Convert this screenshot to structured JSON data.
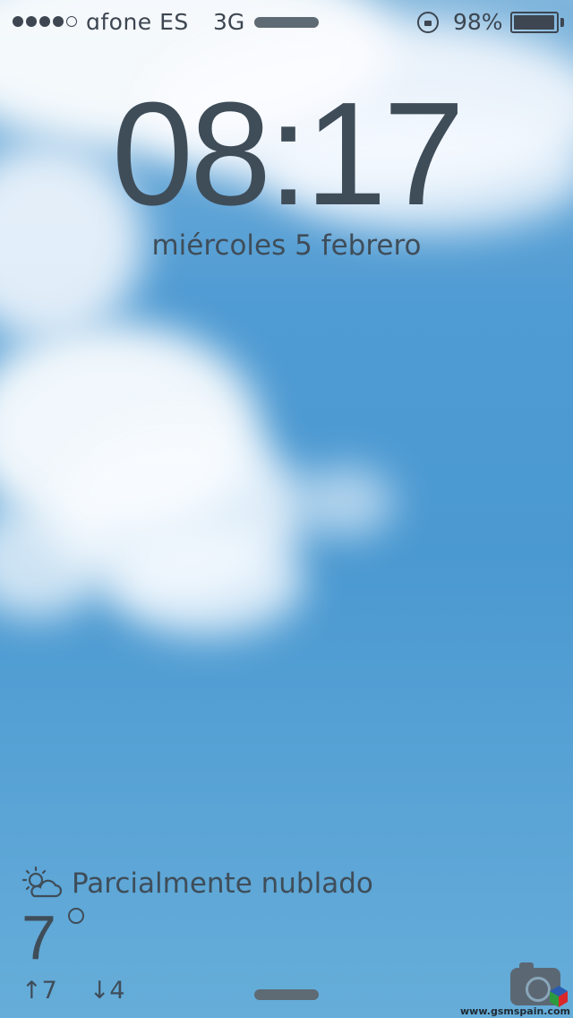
{
  "status_bar": {
    "signal_dots_filled": 4,
    "signal_dots_total": 5,
    "carrier": "ɑfone ES",
    "network": "3G",
    "battery_percent": "98%",
    "battery_level": 0.98,
    "icons": [
      "signal-icon",
      "rotation-lock-icon",
      "battery-icon"
    ]
  },
  "lock_screen": {
    "time": "08:17",
    "date": "miércoles 5 febrero"
  },
  "weather": {
    "icon": "partly-cloudy-icon",
    "condition": "Parcialmente nublado",
    "temperature": "7",
    "high": "↑7",
    "low": "↓4"
  },
  "bottom_bar": {
    "icons": [
      "grabber-handle",
      "camera-icon"
    ]
  },
  "watermark": {
    "text": "www.gsmspain.com"
  }
}
